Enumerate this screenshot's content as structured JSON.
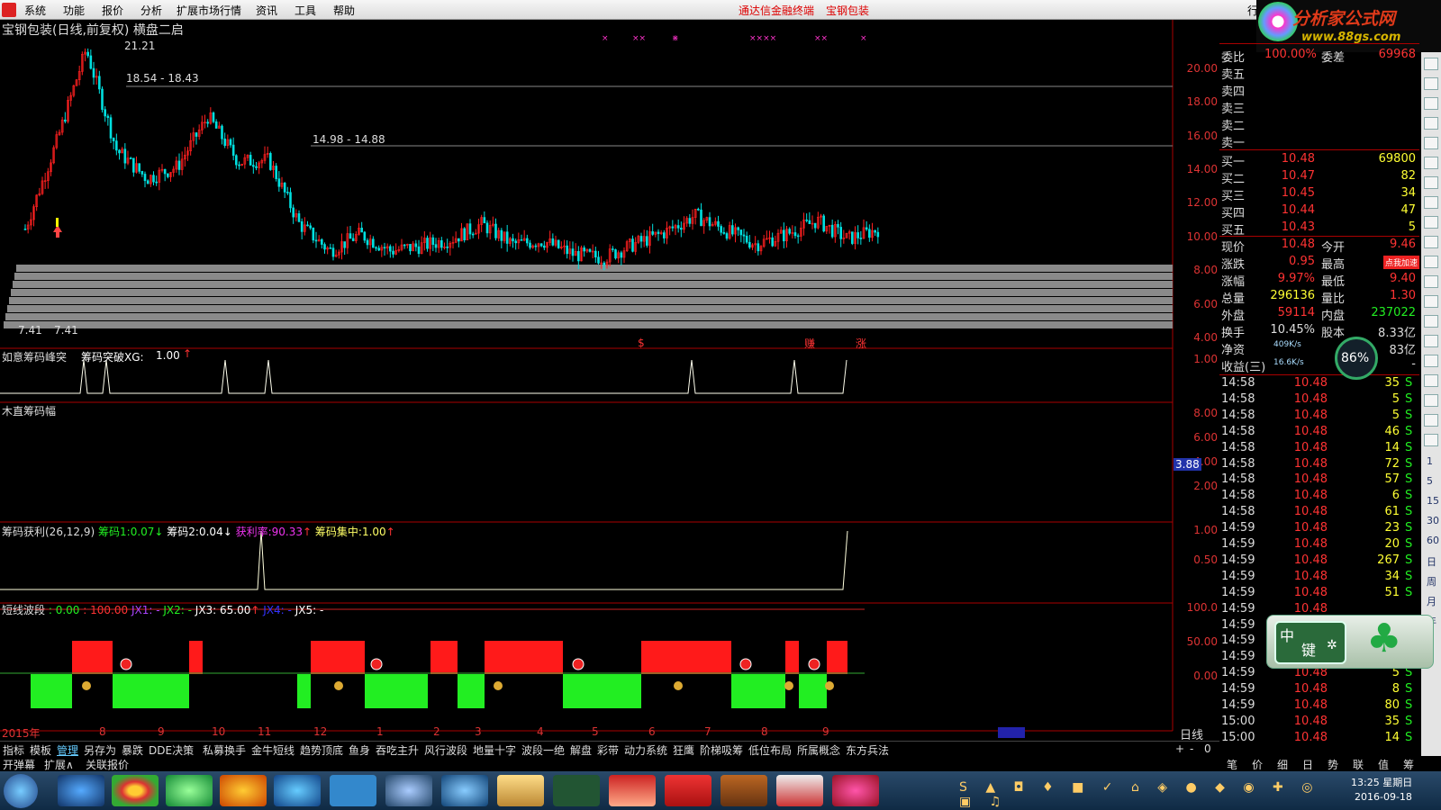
{
  "menubar": {
    "items": [
      "系统",
      "功能",
      "报价",
      "分析",
      "扩展市场行情",
      "资讯",
      "工具",
      "帮助"
    ],
    "center_left": "通达信金融终端",
    "center_right": "宝钢包装",
    "right_tab": "行"
  },
  "brand": {
    "line1": "分析家公式网",
    "line2": "www.88gs.com"
  },
  "main_chart": {
    "title": "宝钢包装(日线,前复权) 横盘二启",
    "high_label": "21.21",
    "res1": "18.54 - 18.43",
    "res2": "14.98 - 14.88",
    "low_labels": [
      "7.41",
      "7.41"
    ],
    "yaxis": [
      "20.00",
      "18.00",
      "16.00",
      "14.00",
      "12.00",
      "10.00",
      "8.00",
      "6.00",
      "4.00"
    ]
  },
  "chart_data": {
    "type": "line",
    "title": "宝钢包装(日线,前复权) 横盘二启",
    "ylim": [
      4,
      22
    ],
    "x": [
      "2015年",
      "8",
      "9",
      "10",
      "11",
      "12",
      "1",
      "2",
      "3",
      "4",
      "5",
      "6",
      "7",
      "8",
      "9"
    ],
    "series": [
      {
        "values": [
          10.5,
          15.5,
          21.2,
          15.2,
          13.5,
          14.2,
          17.2,
          14.5,
          14.6,
          10.8,
          9.2,
          10.2,
          9.2,
          9.5,
          9.9,
          10.8,
          9.6,
          9.8,
          9.0,
          8.8,
          9.6,
          10.3,
          11.3,
          10.4,
          9.6,
          10.2,
          11.0,
          9.9,
          10.48
        ]
      }
    ]
  },
  "ind1": {
    "name": "如意筹码峰突",
    "label": "筹码突破XG:",
    "value": "1.00",
    "arrow": "↑",
    "yaxis": [
      "1.00"
    ],
    "markers": [
      "$",
      "赚",
      "涨"
    ]
  },
  "ind2": {
    "name": "木直筹码幅",
    "yaxis": [
      "8.00",
      "6.00",
      "4.00",
      "2.00"
    ],
    "current": "3.88"
  },
  "ind3": {
    "name": "筹码获利(26,12,9)",
    "c1_label": "筹码1:",
    "c1": "0.07",
    "c1_arrow": "↓",
    "c2_label": "筹码2:",
    "c2": "0.04",
    "c2_arrow": "↓",
    "c3_label": "获利率:",
    "c3": "90.33",
    "c3_arrow": "↑",
    "c4_label": "筹码集中:",
    "c4": "1.00",
    "c4_arrow": "↑",
    "yaxis": [
      "1.00",
      "0.50"
    ]
  },
  "ind4": {
    "name": "短线波段",
    "v1": ": 0.00",
    "v2": ": 100.00",
    "jx1": "JX1:  -",
    "jx2": "JX2:  -",
    "jx3": "JX3: 65.00",
    "jx3_arrow": "↑",
    "jx4": "JX4:  -",
    "jx5": "JX5:  -",
    "yaxis": [
      "100.0",
      "50.00",
      "0.00"
    ]
  },
  "xaxis": [
    "2015年",
    "8",
    "9",
    "10",
    "11",
    "12",
    "1",
    "2",
    "3",
    "4",
    "5",
    "6",
    "7",
    "8",
    "9"
  ],
  "period": "日线",
  "quote": {
    "wb_label": "委比",
    "wb": "100.00%",
    "wc_label": "委差",
    "wc": "69968",
    "sells": [
      "卖五",
      "卖四",
      "卖三",
      "卖二",
      "卖一"
    ],
    "buys": [
      {
        "l": "买一",
        "p": "10.48",
        "v": "69800"
      },
      {
        "l": "买二",
        "p": "10.47",
        "v": "82"
      },
      {
        "l": "买三",
        "p": "10.45",
        "v": "34"
      },
      {
        "l": "买四",
        "p": "10.44",
        "v": "47"
      },
      {
        "l": "买五",
        "p": "10.43",
        "v": "5"
      }
    ],
    "stats": [
      {
        "l1": "现价",
        "v1": "10.48",
        "l2": "今开",
        "v2": "9.46"
      },
      {
        "l1": "涨跌",
        "v1": "0.95",
        "l2": "最高",
        "v2": "10"
      },
      {
        "l1": "涨幅",
        "v1": "9.97%",
        "l2": "最低",
        "v2": "9.40"
      },
      {
        "l1": "总量",
        "v1": "296136",
        "l2": "量比",
        "v2": "1.30"
      },
      {
        "l1": "外盘",
        "v1": "59114",
        "l2": "内盘",
        "v2": "237022"
      },
      {
        "l1": "换手",
        "v1": "10.45%",
        "l2": "股本",
        "v2": "8.33亿"
      },
      {
        "l1": "净资",
        "v1": "",
        "l2": "",
        "v2": "83亿"
      },
      {
        "l1": "收益(三)",
        "v1": "",
        "l2": "",
        "v2": "-"
      }
    ],
    "speed_up": "409K/s",
    "speed_down": "16.6K/s",
    "gauge": "86%",
    "promo": "点我加速"
  },
  "ticks": [
    {
      "t": "14:58",
      "p": "10.48",
      "v": "35",
      "s": "S"
    },
    {
      "t": "14:58",
      "p": "10.48",
      "v": "5",
      "s": "S"
    },
    {
      "t": "14:58",
      "p": "10.48",
      "v": "5",
      "s": "S"
    },
    {
      "t": "14:58",
      "p": "10.48",
      "v": "46",
      "s": "S"
    },
    {
      "t": "14:58",
      "p": "10.48",
      "v": "14",
      "s": "S"
    },
    {
      "t": "14:58",
      "p": "10.48",
      "v": "72",
      "s": "S"
    },
    {
      "t": "14:58",
      "p": "10.48",
      "v": "57",
      "s": "S"
    },
    {
      "t": "14:58",
      "p": "10.48",
      "v": "6",
      "s": "S"
    },
    {
      "t": "14:58",
      "p": "10.48",
      "v": "61",
      "s": "S"
    },
    {
      "t": "14:59",
      "p": "10.48",
      "v": "23",
      "s": "S"
    },
    {
      "t": "14:59",
      "p": "10.48",
      "v": "20",
      "s": "S"
    },
    {
      "t": "14:59",
      "p": "10.48",
      "v": "267",
      "s": "S"
    },
    {
      "t": "14:59",
      "p": "10.48",
      "v": "34",
      "s": "S"
    },
    {
      "t": "14:59",
      "p": "10.48",
      "v": "51",
      "s": "S"
    },
    {
      "t": "14:59",
      "p": "10.48",
      "v": "",
      "s": ""
    },
    {
      "t": "14:59",
      "p": "",
      "v": "",
      "s": ""
    },
    {
      "t": "14:59",
      "p": "",
      "v": "",
      "s": ""
    },
    {
      "t": "14:59",
      "p": "",
      "v": "",
      "s": ""
    },
    {
      "t": "14:59",
      "p": "10.48",
      "v": "5",
      "s": "S"
    },
    {
      "t": "14:59",
      "p": "10.48",
      "v": "8",
      "s": "S"
    },
    {
      "t": "14:59",
      "p": "10.48",
      "v": "80",
      "s": "S"
    },
    {
      "t": "15:00",
      "p": "10.48",
      "v": "35",
      "s": "S"
    },
    {
      "t": "15:00",
      "p": "10.48",
      "v": "14",
      "s": "S"
    }
  ],
  "side_labels": [
    "1",
    "5",
    "15",
    "30",
    "60",
    "日",
    "周",
    "月",
    "年"
  ],
  "tabs1": [
    "指标",
    "模板",
    "管理",
    "另存为",
    "暴跌",
    "DDE决策",
    "私募换手",
    "金牛短线",
    "趋势顶底",
    "鱼身",
    "吞吃主升",
    "风行波段",
    "地量十字",
    "波段一绝",
    "解盘",
    "彩带",
    "动力系统",
    "狂鹰",
    "阶梯吸筹",
    "低位布局",
    "所属概念",
    "东方兵法"
  ],
  "tabs2": [
    "开弹幕",
    "扩展∧",
    "关联报价"
  ],
  "tabs_right": [
    "+",
    "-",
    "0"
  ],
  "bottom_right_tabs": [
    "笔",
    "价",
    "细",
    "日",
    "势",
    "联",
    "值",
    "筹"
  ],
  "widget": {
    "t1": "中",
    "t2": "键"
  },
  "taskbar": {
    "time": "13:25 星期日",
    "date": "2016-09-18"
  },
  "colors": {
    "up": "#ff2020",
    "down": "#00e0e0",
    "bar_red": "#ff1a1a",
    "bar_green": "#22ee22"
  }
}
